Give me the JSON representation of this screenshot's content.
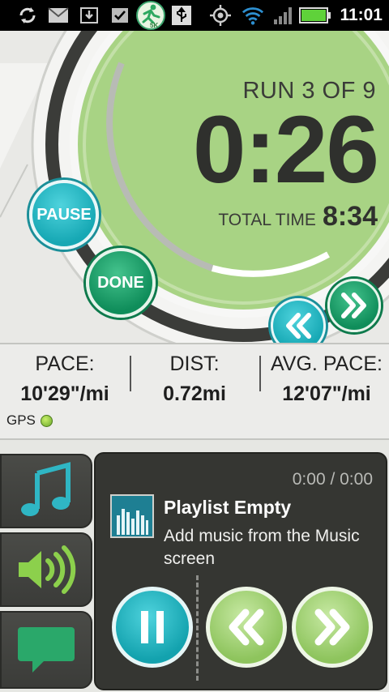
{
  "status_bar": {
    "time": "11:01",
    "icons": [
      "sync-icon",
      "gmail-icon",
      "download-icon",
      "market-update-icon",
      "5k-runner-app-icon",
      "usb-icon",
      "gps-icon",
      "wifi-icon",
      "signal-icon",
      "battery-icon"
    ],
    "app_badge": "5K"
  },
  "run": {
    "run_label": "RUN 3 OF 9",
    "elapsed": "0:26",
    "total_label": "TOTAL TIME",
    "total_time": "8:34",
    "pause_label": "PAUSE",
    "done_label": "DONE"
  },
  "stats": {
    "pace_label": "PACE:",
    "pace_value": "10'29\"/mi",
    "dist_label": "DIST:",
    "dist_value": "0.72mi",
    "avg_label": "AVG. PACE:",
    "avg_value": "12'07\"/mi",
    "gps_label": "GPS"
  },
  "player": {
    "time": "0:00 / 0:00",
    "title": "Playlist Empty",
    "message": "Add music from the Music screen"
  },
  "colors": {
    "teal": "#16a8b4",
    "green": "#0f8d5a",
    "light_green": "#9dd070",
    "dial_green": "#a8d384",
    "dark_panel": "#353632"
  }
}
